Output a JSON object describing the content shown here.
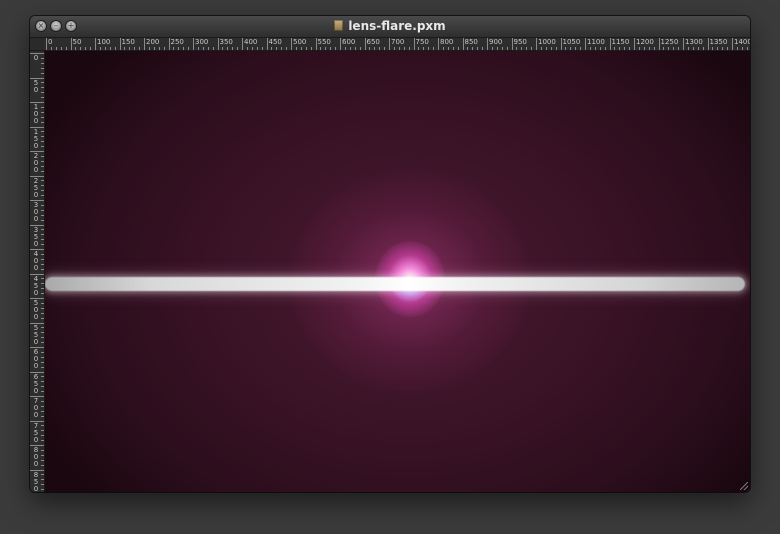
{
  "window": {
    "title": "lens-flare.pxm",
    "file_icon": "document-icon"
  },
  "title_buttons": {
    "close_glyph": "×",
    "minimize_glyph": "–",
    "zoom_glyph": "+"
  },
  "rulers": {
    "horizontal": [
      "0",
      "50",
      "100",
      "150",
      "200",
      "250",
      "300",
      "350",
      "400",
      "450",
      "500",
      "550",
      "600",
      "650",
      "700",
      "750",
      "800",
      "850",
      "900",
      "950",
      "1000",
      "1050",
      "1100",
      "1150",
      "1200",
      "1250",
      "1300",
      "1350",
      "1400"
    ],
    "vertical": [
      "0",
      "50",
      "100",
      "150",
      "200",
      "250",
      "300",
      "350",
      "400",
      "450",
      "500",
      "550",
      "600",
      "650",
      "700",
      "750",
      "800",
      "850"
    ]
  },
  "colors": {
    "canvas_background": "#3a1326",
    "flare_core": "#ff8ce6",
    "flare_streak": "#ffffff"
  }
}
